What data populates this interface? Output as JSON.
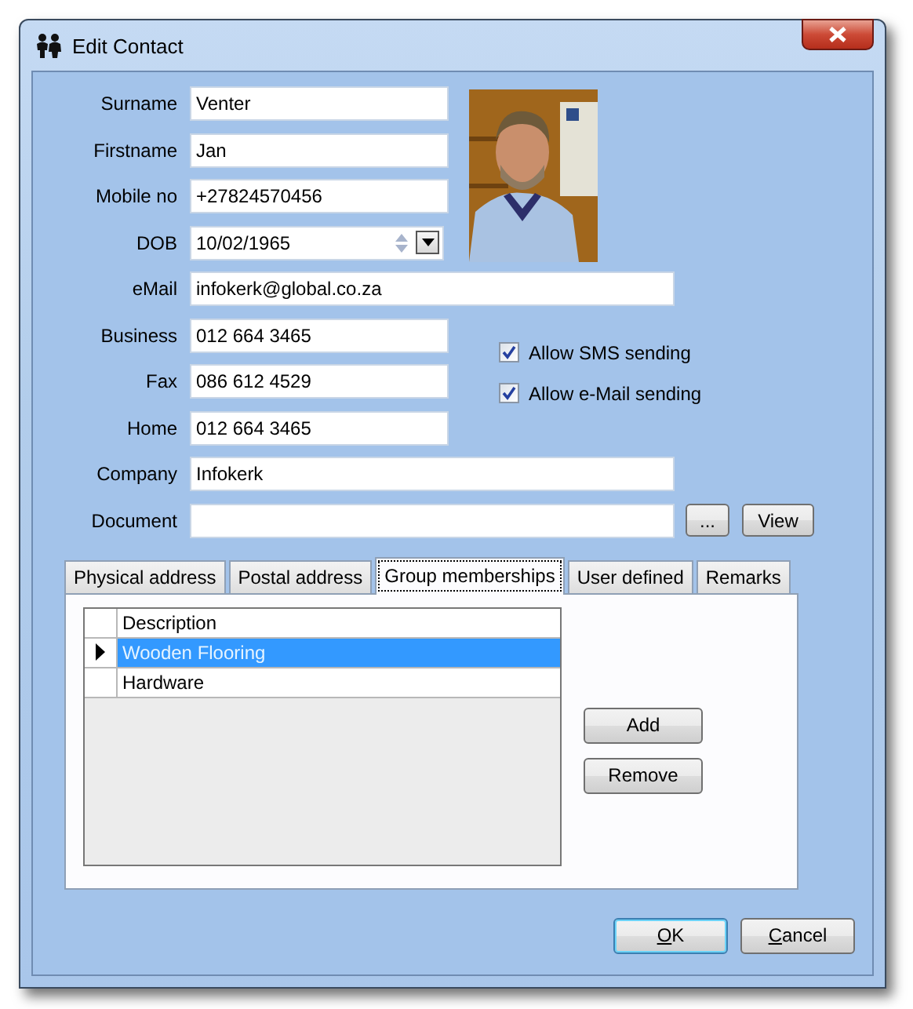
{
  "window": {
    "title": "Edit Contact"
  },
  "fields": [
    {
      "label": "Surname",
      "value": "Venter",
      "kind": "text"
    },
    {
      "label": "Firstname",
      "value": "Jan",
      "kind": "text"
    },
    {
      "label": "Mobile no",
      "value": "+27824570456",
      "kind": "text"
    },
    {
      "label": "DOB",
      "value": "10/02/1965",
      "kind": "date"
    },
    {
      "label": "eMail",
      "value": "infokerk@global.co.za",
      "kind": "wide"
    },
    {
      "label": "Business",
      "value": "012 664 3465",
      "kind": "text"
    },
    {
      "label": "Fax",
      "value": "086 612 4529",
      "kind": "text"
    },
    {
      "label": "Home",
      "value": "012 664 3465",
      "kind": "text"
    },
    {
      "label": "Company",
      "value": "Infokerk",
      "kind": "wide"
    },
    {
      "label": "Document",
      "kind": "document"
    }
  ],
  "checkboxes": [
    {
      "label": "Allow SMS sending",
      "checked": true
    },
    {
      "label": "Allow e-Mail sending",
      "checked": true
    }
  ],
  "document_buttons": [
    "...",
    "View"
  ],
  "tabs": [
    {
      "label": "Physical address",
      "selected": false
    },
    {
      "label": "Postal address",
      "selected": false
    },
    {
      "label": "Group memberships",
      "selected": true
    },
    {
      "label": "User defined",
      "selected": false
    },
    {
      "label": "Remarks",
      "selected": false
    }
  ],
  "group_table": {
    "columns": [
      "Description"
    ],
    "rows": [
      {
        "description": "Wooden Flooring",
        "selected": true
      },
      {
        "description": "Hardware",
        "selected": false
      }
    ]
  },
  "group_buttons": [
    "Add",
    "Remove"
  ],
  "dialog_buttons": [
    {
      "label": "OK",
      "underline_first": true,
      "default": true
    },
    {
      "label": "Cancel",
      "underline_first": true,
      "default": false
    }
  ]
}
